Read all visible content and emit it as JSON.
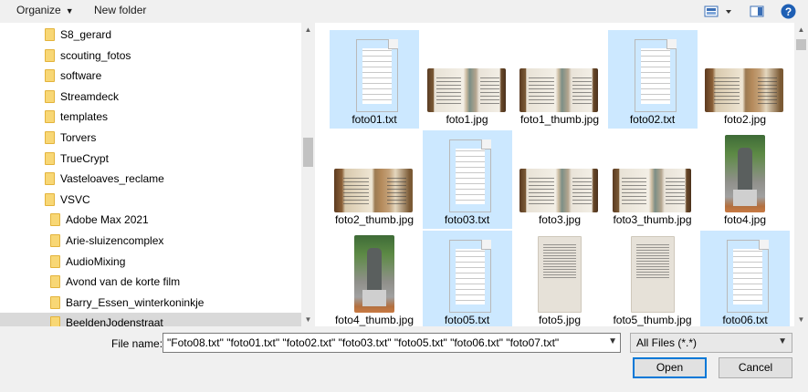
{
  "toolbar": {
    "organize_label": "Organize",
    "new_folder_label": "New folder",
    "view_icon": "view-options-icon",
    "preview_icon": "preview-pane-icon",
    "help_icon": "help-icon"
  },
  "nav": {
    "items": [
      {
        "label": "S8_gerard"
      },
      {
        "label": "scouting_fotos"
      },
      {
        "label": "software"
      },
      {
        "label": "Streamdeck"
      },
      {
        "label": "templates"
      },
      {
        "label": "Torvers"
      },
      {
        "label": "TrueCrypt"
      },
      {
        "label": "Vasteloaves_reclame"
      },
      {
        "label": "VSVC"
      },
      {
        "label": "Adobe Max 2021"
      },
      {
        "label": "Arie-sluizencomplex"
      },
      {
        "label": "AudioMixing"
      },
      {
        "label": "Avond van de korte film"
      },
      {
        "label": "Barry_Essen_winterkoninkje"
      },
      {
        "label": "BeeldenJodenstraat"
      }
    ]
  },
  "files": [
    {
      "name": "foto01.txt",
      "kind": "txt",
      "selected": true
    },
    {
      "name": "foto1.jpg",
      "kind": "land",
      "selected": false
    },
    {
      "name": "foto1_thumb.jpg",
      "kind": "land",
      "selected": false
    },
    {
      "name": "foto02.txt",
      "kind": "txt",
      "selected": true
    },
    {
      "name": "foto2.jpg",
      "kind": "land-warm",
      "selected": false
    },
    {
      "name": "foto2_thumb.jpg",
      "kind": "land-warm",
      "selected": false
    },
    {
      "name": "foto03.txt",
      "kind": "txt",
      "selected": true
    },
    {
      "name": "foto3.jpg",
      "kind": "land",
      "selected": false
    },
    {
      "name": "foto3_thumb.jpg",
      "kind": "land",
      "selected": false
    },
    {
      "name": "foto4.jpg",
      "kind": "port",
      "selected": false
    },
    {
      "name": "foto4_thumb.jpg",
      "kind": "port",
      "selected": false
    },
    {
      "name": "foto05.txt",
      "kind": "txt",
      "selected": true
    },
    {
      "name": "foto5.jpg",
      "kind": "page",
      "selected": false
    },
    {
      "name": "foto5_thumb.jpg",
      "kind": "page",
      "selected": false
    },
    {
      "name": "foto06.txt",
      "kind": "txt",
      "selected": true
    }
  ],
  "footer": {
    "file_name_label": "File name:",
    "file_name_value": "\"Foto08.txt\" \"foto01.txt\" \"foto02.txt\" \"foto03.txt\" \"foto05.txt\" \"foto06.txt\" \"foto07.txt\"",
    "file_type_value": "All Files (*.*)",
    "open_label": "Open",
    "cancel_label": "Cancel"
  },
  "colors": {
    "selection": "#cce8ff",
    "nav_selected": "#d9d9d9",
    "folder": "#f8d775",
    "help": "#1e5fb4",
    "accent": "#0078d7"
  }
}
